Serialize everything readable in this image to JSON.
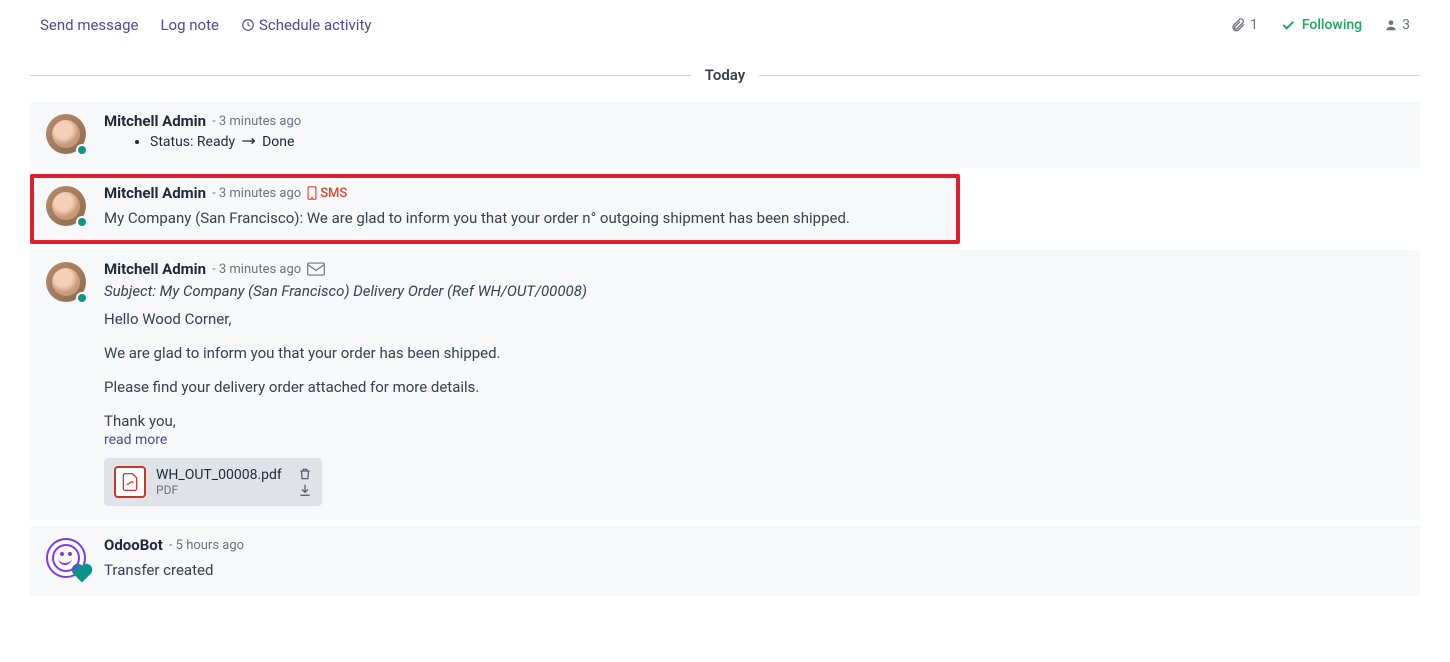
{
  "toolbar": {
    "send_message": "Send message",
    "log_note": "Log note",
    "schedule_activity": "Schedule activity",
    "attachments_count": "1",
    "following": "Following",
    "followers_count": "3"
  },
  "date_separator": "Today",
  "messages": [
    {
      "author": "Mitchell Admin",
      "time": "- 3 minutes ago",
      "status_label": "Status:",
      "status_from": "Ready",
      "status_to": "Done"
    },
    {
      "author": "Mitchell Admin",
      "time": "- 3 minutes ago",
      "badge": "SMS",
      "body": "My Company (San Francisco): We are glad to inform you that your order n° outgoing shipment has been shipped."
    },
    {
      "author": "Mitchell Admin",
      "time": "- 3 minutes ago",
      "subject": "Subject: My Company (San Francisco) Delivery Order (Ref WH/OUT/00008)",
      "greeting": "Hello Wood Corner,",
      "line1": "We are glad to inform you that your order has been shipped.",
      "line2": "Please find your delivery order attached for more details.",
      "signoff": "Thank you,",
      "read_more": "read more",
      "attachment": {
        "name": "WH_OUT_00008.pdf",
        "type": "PDF"
      }
    },
    {
      "author": "OdooBot",
      "time": "- 5 hours ago",
      "body": "Transfer created"
    }
  ]
}
